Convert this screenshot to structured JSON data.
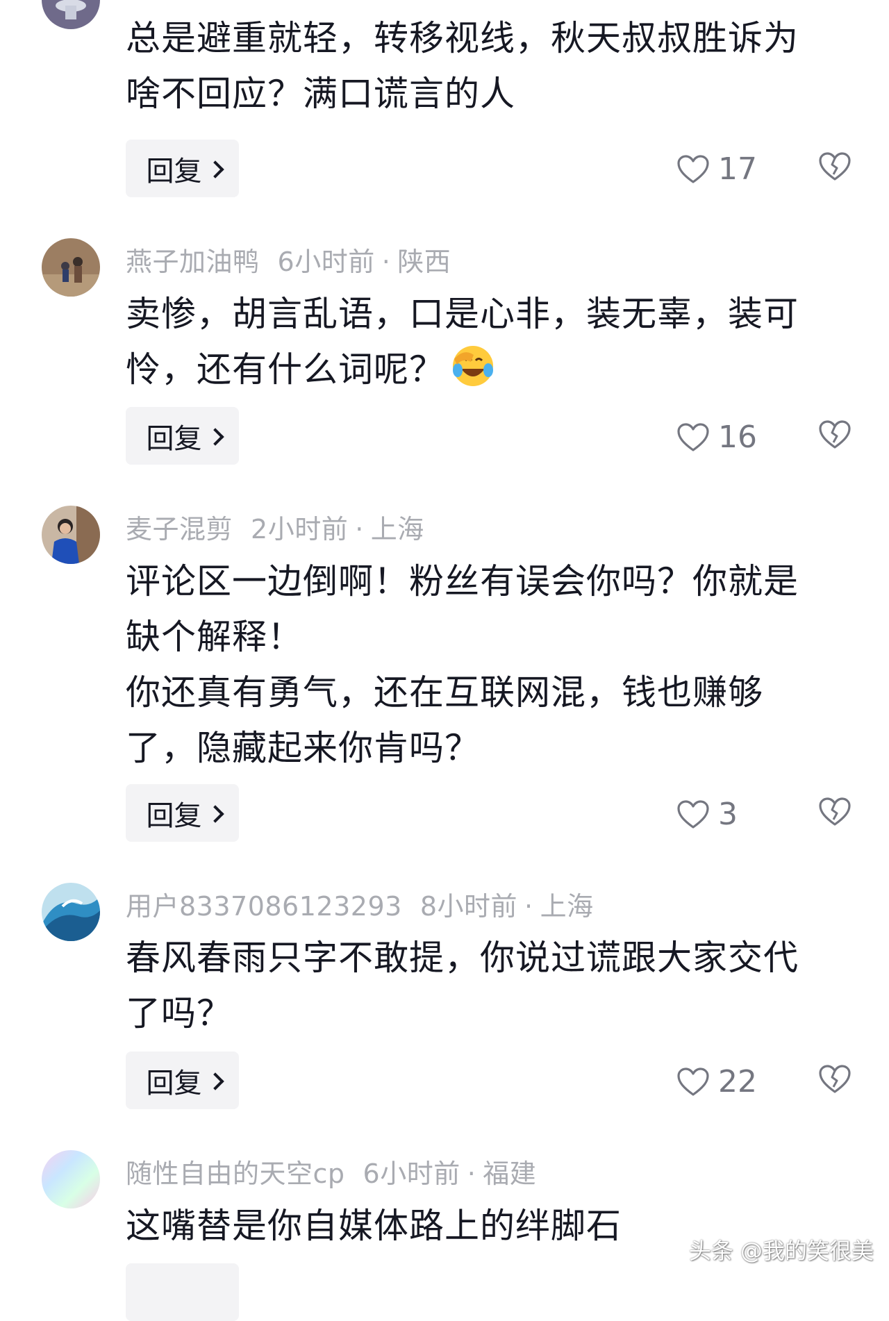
{
  "comments": [
    {
      "username": "",
      "time": "",
      "location": "",
      "lines": [
        "总是避重就轻，转移视线，秋天叔叔胜诉为",
        "啥不回应？满口谎言的人"
      ],
      "reply_label": "回复",
      "likes": "17"
    },
    {
      "username": "燕子加油鸭",
      "time": "6小时前",
      "location": "陕西",
      "lines": [
        "卖惨，胡言乱语，口是心非，装无辜，装可",
        "怜，还有什么词呢？"
      ],
      "emoji": "laughing-face-emoji",
      "reply_label": "回复",
      "likes": "16"
    },
    {
      "username": "麦子混剪",
      "time": "2小时前",
      "location": "上海",
      "lines": [
        "评论区一边倒啊！粉丝有误会你吗？你就是",
        "缺个解释！",
        "你还真有勇气，还在互联网混，钱也赚够",
        "了，隐藏起来你肯吗？"
      ],
      "reply_label": "回复",
      "likes": "3"
    },
    {
      "username": "用户8337086123293",
      "time": "8小时前",
      "location": "上海",
      "lines": [
        "春风春雨只字不敢提，你说过谎跟大家交代",
        "了吗？"
      ],
      "reply_label": "回复",
      "likes": "22"
    },
    {
      "username": "随性自由的天空cp",
      "time": "6小时前",
      "location": "福建",
      "lines": [
        "这嘴替是你自媒体路上的绊脚石"
      ],
      "reply_label": "",
      "likes": ""
    }
  ],
  "icons": {
    "like": "heart-outline-icon",
    "dislike": "broken-heart-icon",
    "reply_chevron": "chevron-right-icon"
  },
  "colors": {
    "meta_text": "#a9abb1",
    "body_text": "#161823",
    "reply_bg": "#f3f3f5",
    "count_text": "#747680"
  },
  "watermark": "头条 @我的笑很美"
}
